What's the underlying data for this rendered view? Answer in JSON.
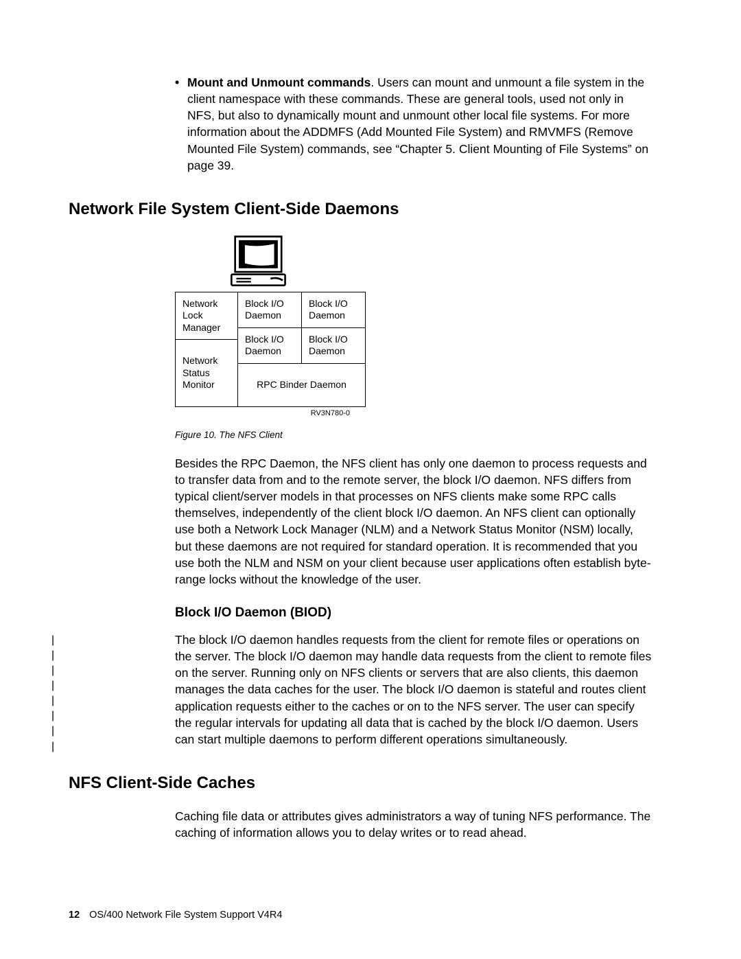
{
  "bullet": {
    "title": "Mount and Unmount commands",
    "text": ". Users can mount and unmount a file system in the client namespace with these commands. These are general tools, used not only in NFS, but also to dynamically mount and unmount other local file systems. For more information about the ADDMFS (Add Mounted File System) and RMVMFS (Remove Mounted File System) commands, see “Chapter 5. Client Mounting of File Systems” on page 39."
  },
  "headings": {
    "h1a": "Network File System Client-Side Daemons",
    "h2a": "Block I/O Daemon (BIOD)",
    "h1b": "NFS Client-Side Caches"
  },
  "figure": {
    "cells": {
      "nlm": "Network Lock Manager",
      "nsm": "Network Status Monitor",
      "biod": "Block I/O Daemon",
      "rpc": "RPC Binder Daemon"
    },
    "ref": "RV3N780-0",
    "caption": "Figure 10. The NFS Client"
  },
  "paras": {
    "p1": "Besides the RPC Daemon, the NFS client has only one daemon to process requests and to transfer data from and to the remote server, the block I/O daemon. NFS differs from typical client/server models in that processes on NFS clients make some RPC calls themselves, independently of the client block I/O daemon. An NFS client can optionally use both a Network Lock Manager (NLM) and a Network Status Monitor (NSM) locally, but these daemons are not required for standard operation. It is recommended that you use both the NLM and NSM on your client because user applications often establish byte-range locks without the knowledge of the user.",
    "p2": "The block I/O daemon handles requests from the client for remote files or operations on the server. The block I/O daemon may handle data requests from the client to remote files on the server. Running only on NFS clients or servers that are also clients, this daemon manages the data caches for the user. The block I/O daemon is stateful and routes client application requests either to the caches or on to the NFS server. The user can specify the regular intervals for updating all data that is cached by the block I/O daemon. Users can start multiple daemons to perform different operations simultaneously.",
    "p3": "Caching file data or attributes gives administrators a way of tuning NFS performance. The caching of information allows you to delay writes or to read ahead."
  },
  "footer": {
    "page": "12",
    "title": "OS/400 Network File System Support V4R4"
  }
}
